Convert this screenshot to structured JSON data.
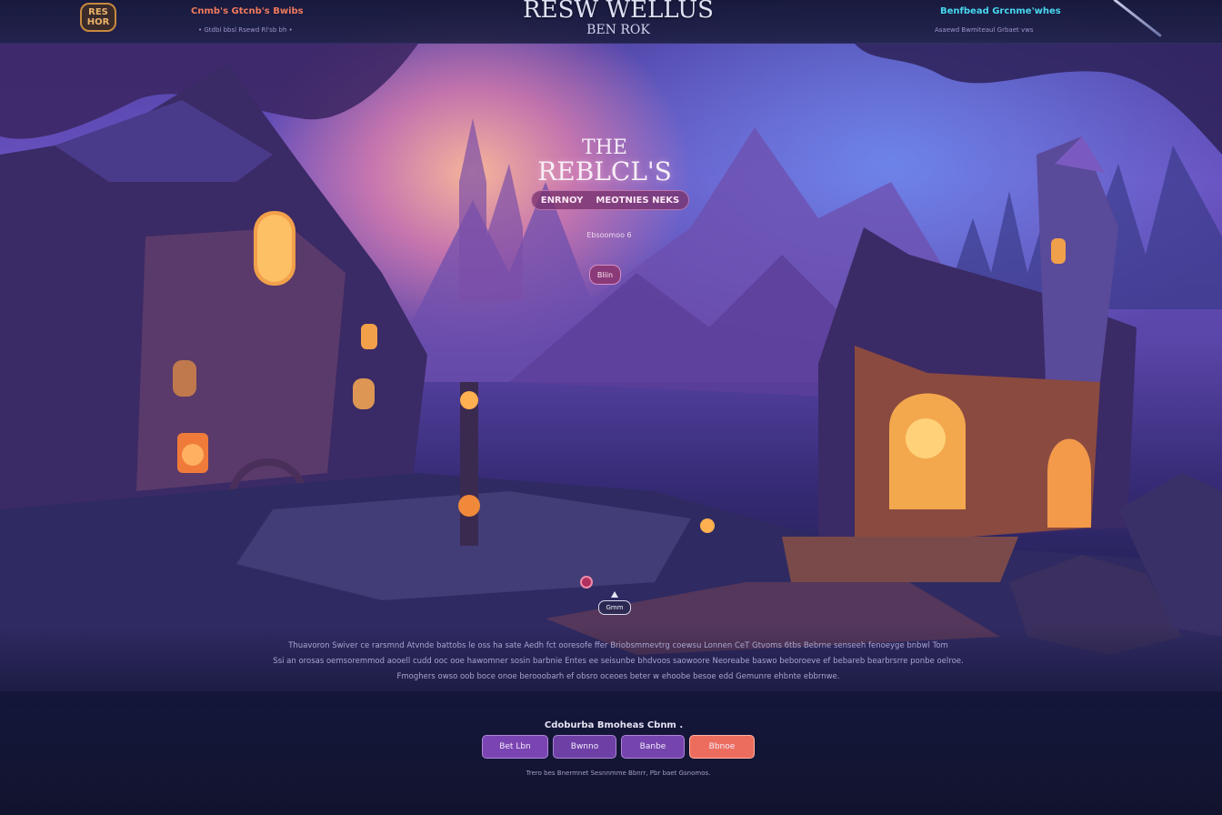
{
  "header": {
    "logo_text": "RES HOR",
    "promo_left": "Cnmb's Gtcnb's Bwibs",
    "sub_left": "• Gtdbl bbsl  Rsewd  Rl'sb bh •",
    "site_title": "RESW WELLUS",
    "site_subtitle": "BEN ROK",
    "promo_right": "Benfbead Grcnme'whes",
    "sub_right": "Asaewd Bwmiteaul Grbaet vws"
  },
  "hero": {
    "kicker": "THE",
    "title": "REBLCL'S",
    "tag_left": "ENRNOY",
    "tag_right": "MEOTNIES NEKS",
    "small_text": "Ebsoomoo 6",
    "button_label": "Bliin"
  },
  "map": {
    "marker_label": "Gmm"
  },
  "description": {
    "line1": "Thuavoron Swiver ce rarsmnd Atvnde battobs le oss ha sate Aedh fct ooresofe ffer Briobsmmevtrg coewsu Lonnen CeT Gtvoms 6tbs Bebrne senseeh fenoeyge bnbwl Tom",
    "line2": "Ssi an orosas oemsoremmod aooell cudd ooc ooe hawomner sosin barbnie Entes ee seisunbe bhdvoos saowoore Neoreabe baswo beboroeve ef bebareb bearbrsrre ponbe oelroe.",
    "line3": "Fmoghers owso oob boce onoe berooobarh ef obsro oceoes beter w ehoobe besoe edd Gemunre ehbnte ebbrnwe."
  },
  "actions": {
    "heading": "Cdoburba Bmoheas Cbnm .",
    "buttons": [
      "Bet Lbn",
      "Bwnno",
      "Banbe",
      "Bbnoe"
    ],
    "footer": "Trero bes Bnermnet Sesnnmme Bbnrr, Pbr baet Gsnomos."
  },
  "colors": {
    "accent_coral": "#ec6d5e",
    "accent_cyan": "#48d8f0",
    "accent_purple": "#7a44b2",
    "logo_gold": "#c7893f"
  }
}
